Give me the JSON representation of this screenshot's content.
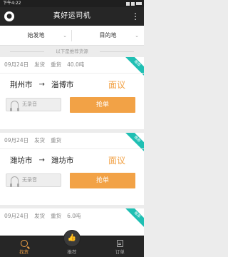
{
  "status_bar": {
    "time": "下午4:22"
  },
  "header": {
    "logo_glyph": "●",
    "title": "真好运司机",
    "more_glyph": "⋮"
  },
  "filters": {
    "origin_label": "始发地",
    "destination_label": "目的地",
    "chevron_glyph": "⌄"
  },
  "divider_text": "以下是推荐货源",
  "cards": [
    {
      "date": "09月24日",
      "status": "发货",
      "type": "重货",
      "weight": "40.0吨",
      "ribbon": "推荐",
      "from": "荆州市",
      "arrow": "→",
      "to": "淄博市",
      "price": "面议",
      "audio_label": "无录音",
      "action_label": "抢单"
    },
    {
      "date": "09月24日",
      "status": "发货",
      "type": "重货",
      "weight": "",
      "ribbon": "推荐",
      "from": "潍坊市",
      "arrow": "→",
      "to": "潍坊市",
      "price": "面议",
      "audio_label": "无录音",
      "action_label": "抢单"
    },
    {
      "date": "09月24日",
      "status": "发货",
      "type": "重货",
      "weight": "6.0吨",
      "ribbon": "推荐"
    }
  ],
  "tabs": [
    {
      "label": "找货",
      "icon": "search-icon",
      "active": true
    },
    {
      "label": "推荐",
      "icon": "thumbs-up-icon",
      "active": false
    },
    {
      "label": "订单",
      "icon": "order-icon",
      "active": false
    }
  ],
  "colors": {
    "accent_orange": "#f2a246",
    "ribbon_teal": "#1fbfb3",
    "header_dark": "#262626"
  }
}
